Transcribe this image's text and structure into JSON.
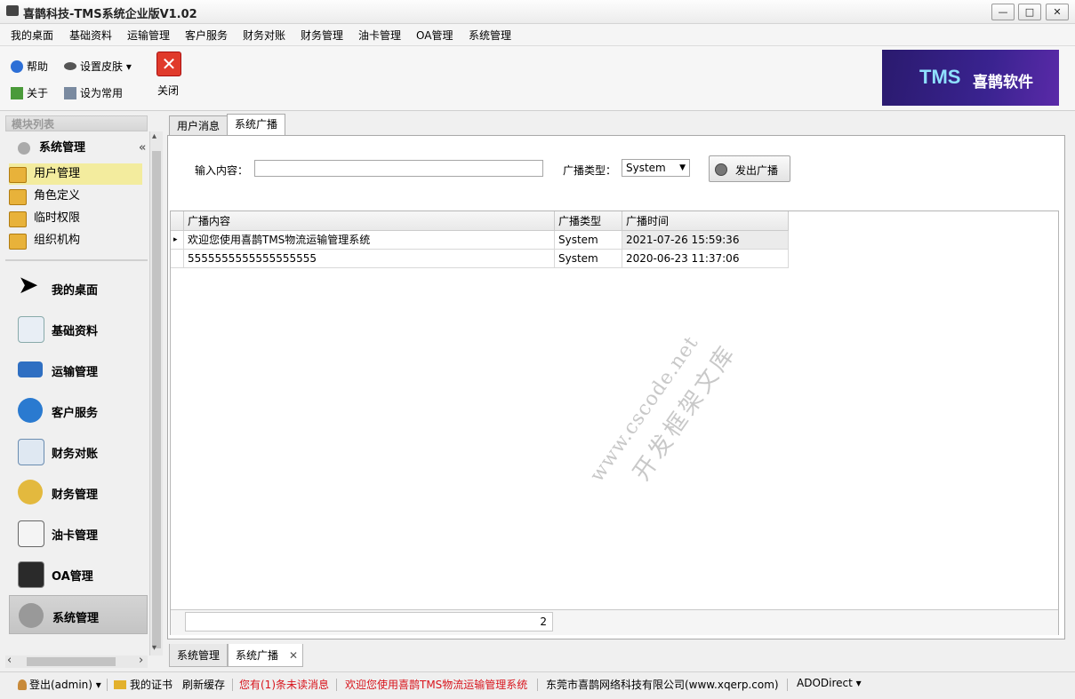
{
  "window": {
    "title": "喜鹊科技-TMS系统企业版V1.02",
    "min": "—",
    "max": "□",
    "close": "✕"
  },
  "menu": [
    "我的桌面",
    "基础资料",
    "运输管理",
    "客户服务",
    "财务对账",
    "财务管理",
    "油卡管理",
    "OA管理",
    "系统管理"
  ],
  "ribbon": {
    "help": "帮助",
    "skin": "设置皮肤 ▾",
    "about": "关于",
    "set_common": "设为常用",
    "close": "关闭",
    "logo_tms": "TMS",
    "logo_text": "喜鹊软件"
  },
  "left_panel": {
    "header": "模块列表",
    "group": "系统管理",
    "collapse": "«",
    "sub_items": [
      "用户管理",
      "角色定义",
      "临时权限",
      "组织机构"
    ],
    "nav": [
      "我的桌面",
      "基础资料",
      "运输管理",
      "客户服务",
      "财务对账",
      "财务管理",
      "油卡管理",
      "OA管理",
      "系统管理"
    ],
    "scroll_left": "‹",
    "scroll_right": "›",
    "scroll_up": "▴",
    "scroll_down": "▾"
  },
  "tabs": [
    "用户消息",
    "系统广播"
  ],
  "broadcast": {
    "input_label": "输入内容：",
    "input_value": "",
    "type_label": "广播类型：",
    "type_value": "System",
    "send_button": "发出广播"
  },
  "grid": {
    "columns": [
      "广播内容",
      "广播类型",
      "广播时间"
    ],
    "rows": [
      [
        "欢迎您使用喜鹊TMS物流运输管理系统",
        "System",
        "2021-07-26 15:59:36"
      ],
      [
        "5555555555555555555",
        "System",
        "2020-06-23 11:37:06"
      ]
    ],
    "row_indicator": "▸",
    "footer_count": "2"
  },
  "watermark": {
    "line1": "www.cscode.net",
    "line2": "开发框架文库"
  },
  "doc_tabs": [
    "系统管理",
    "系统广播"
  ],
  "doc_tab_close": "✕",
  "status": {
    "logout": "登出(admin) ▾",
    "cert": "我的证书",
    "refresh": "刷新缓存",
    "unread": "您有(1)条未读消息",
    "welcome": "欢迎您使用喜鹊TMS物流运输管理系统",
    "company": "东莞市喜鹊网络科技有限公司(www.xqerp.com)",
    "db": "ADODirect ▾"
  },
  "colors": {
    "selected_item": "#f3ec9e",
    "status_red": "#d8141c",
    "logo_bg": "#3a2390"
  }
}
